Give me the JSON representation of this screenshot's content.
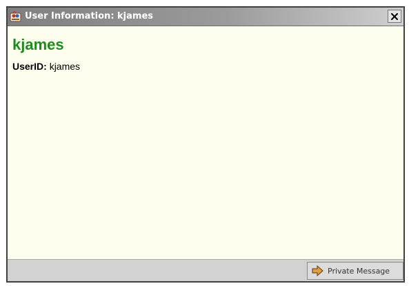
{
  "window": {
    "title": "User Information: kjames",
    "close_label": "✕"
  },
  "profile": {
    "display_name": "kjames",
    "userid_label": "UserID:",
    "userid_value": "kjames"
  },
  "footer": {
    "private_message_label": "Private Message"
  },
  "colors": {
    "name_green": "#1f8a1f",
    "content_bg": "#fefeee",
    "footer_bg": "#d2d2d2",
    "arrow_orange": "#d08a2a"
  },
  "icons": {
    "title_icon": "app-logo-icon",
    "close_icon": "close-icon",
    "message_icon": "arrow-right-icon"
  }
}
